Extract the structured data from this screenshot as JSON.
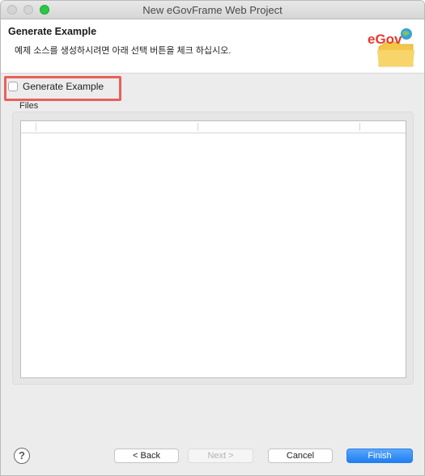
{
  "window": {
    "title": "New eGovFrame Web Project"
  },
  "header": {
    "title": "Generate Example",
    "description": "예제 소스를 생성하시려면 아래 선택 버튼을 체크 하십시오.",
    "logo_text": "eGov"
  },
  "content": {
    "generate_example": {
      "label": "Generate Example",
      "checked": false
    },
    "files_label": "Files",
    "files_table": {
      "columns": [
        "",
        "",
        "",
        ""
      ],
      "rows": []
    }
  },
  "buttons": {
    "help": "?",
    "back": "< Back",
    "next": "Next >",
    "cancel": "Cancel",
    "finish": "Finish"
  },
  "colors": {
    "highlight": "#e8605a",
    "finish": "#1e7ff1",
    "logo_red": "#e23b2e",
    "folder_yellow": "#f3c64a"
  }
}
